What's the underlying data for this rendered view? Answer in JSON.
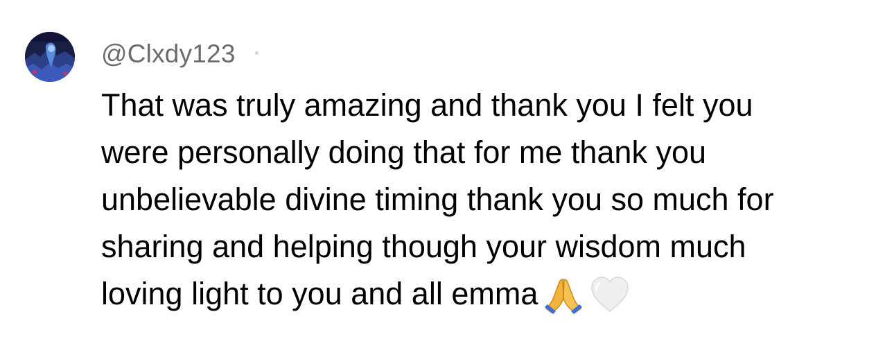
{
  "comment": {
    "username": "@Clxdy123",
    "lines": [
      "That was truly amazing and thank you I felt you",
      "were personally doing that for me thank you",
      "unbelievable divine timing thank you so much for",
      "sharing and helping though your wisdom much",
      "loving light to you and all emma"
    ],
    "emojis": [
      "folded-hands-icon",
      "white-heart-icon"
    ]
  },
  "colors": {
    "username": "#6b6b6b",
    "text": "#000000",
    "background": "#ffffff",
    "hands": "#f4b43b",
    "heart": "#ededed"
  }
}
